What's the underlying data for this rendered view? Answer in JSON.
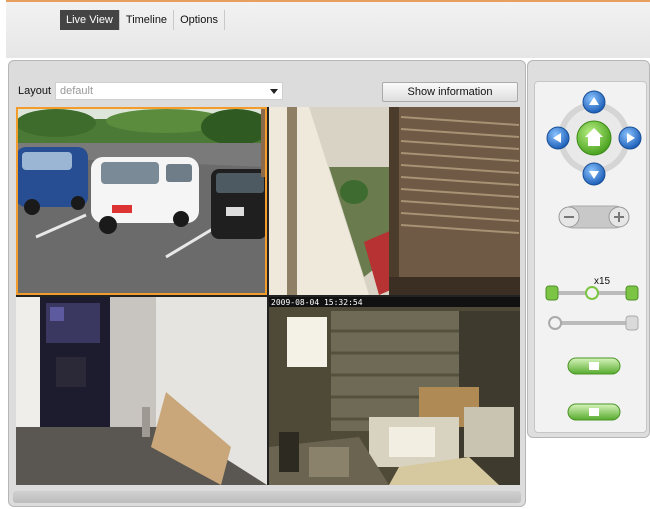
{
  "tabs": [
    {
      "label": "Live View",
      "active": true
    },
    {
      "label": "Timeline",
      "active": false
    },
    {
      "label": "Options",
      "active": false
    }
  ],
  "layout": {
    "label": "Layout",
    "selected": "default"
  },
  "show_information_label": "Show information",
  "cameras": [
    {
      "name": "parking-lot",
      "timestamp": "",
      "selected": true
    },
    {
      "name": "entrance-door",
      "timestamp": "",
      "selected": false
    },
    {
      "name": "hallway",
      "timestamp": "",
      "selected": false
    },
    {
      "name": "garage-storage",
      "timestamp": "2009-08-04 15:32:54",
      "selected": false
    }
  ],
  "ptz": {
    "zoom_label": "x15",
    "zoom_level": 0.5,
    "focus_level": 0.05,
    "icons": [
      "pan-up-icon",
      "pan-down-icon",
      "pan-left-icon",
      "pan-right-icon",
      "home-icon",
      "zoom-out-icon",
      "zoom-in-icon",
      "snapshot-icon",
      "record-icon"
    ]
  },
  "colors": {
    "accent_orange": "#f39c2b",
    "active_tab": "#444444",
    "ptz_blue": "#2f7fd8",
    "ptz_green": "#6fc23a"
  }
}
